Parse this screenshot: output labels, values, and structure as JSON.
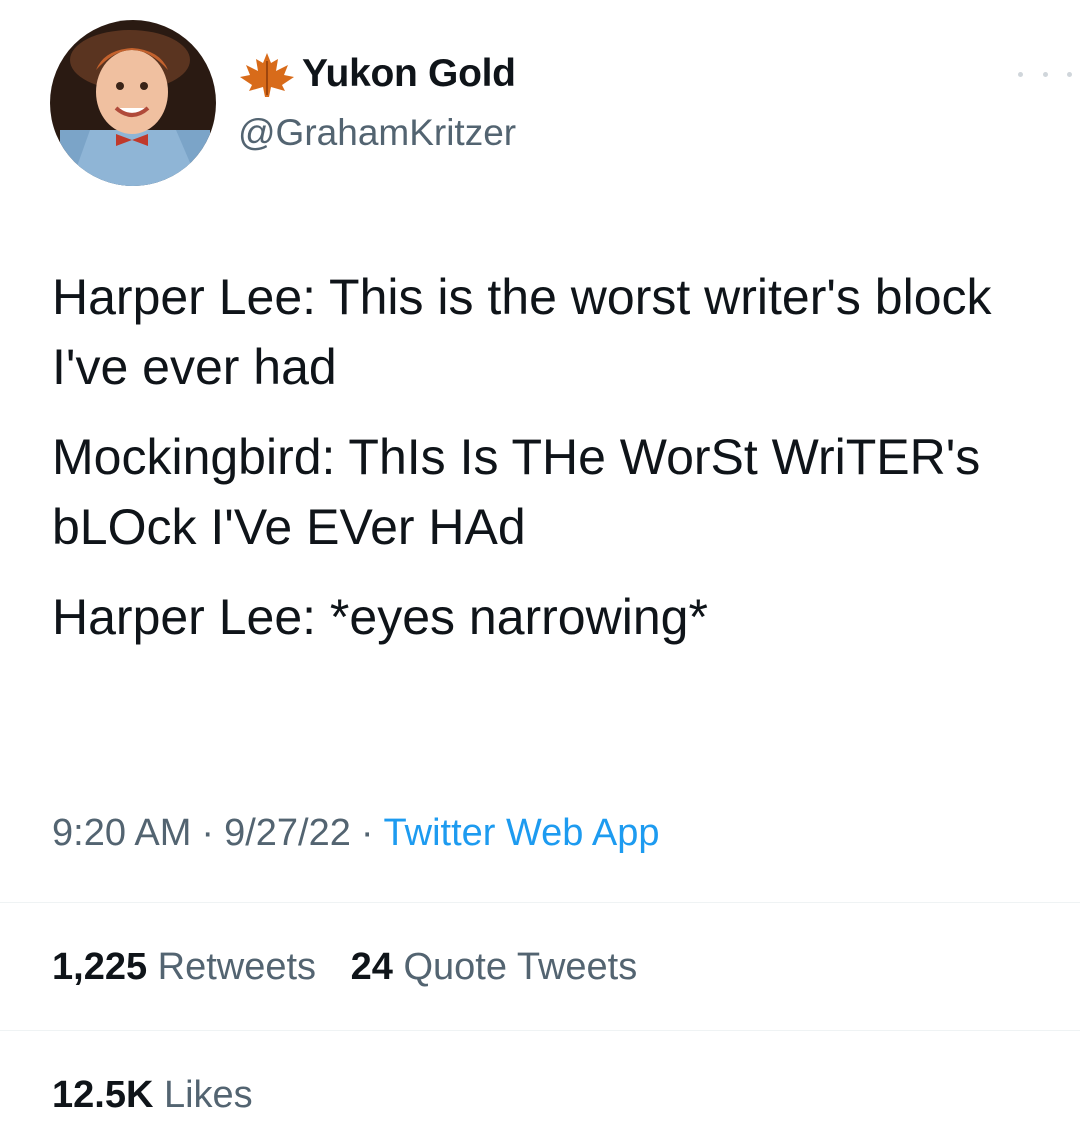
{
  "author": {
    "display_name": "Yukon Gold",
    "handle": "@GrahamKritzer",
    "badge_icon": "maple-leaf-icon",
    "badge_color": "#d86b1a"
  },
  "tweet": {
    "paragraphs": [
      "Harper Lee: This is the worst writer's block I've ever had",
      "Mockingbird: ThIs Is THe WorSt WriTER's bLOck I'Ve EVer HAd",
      "Harper Lee: *eyes narrowing*"
    ]
  },
  "meta": {
    "time": "9:20 AM",
    "date": "9/27/22",
    "separator": "·",
    "source": "Twitter Web App"
  },
  "stats": {
    "retweets_count": "1,225",
    "retweets_label": "Retweets",
    "quotes_count": "24",
    "quotes_label": "Quote Tweets",
    "likes_count": "12.5K",
    "likes_label": "Likes"
  },
  "colors": {
    "text": "#0f1419",
    "secondary": "#536471",
    "link": "#1d9bf0"
  }
}
